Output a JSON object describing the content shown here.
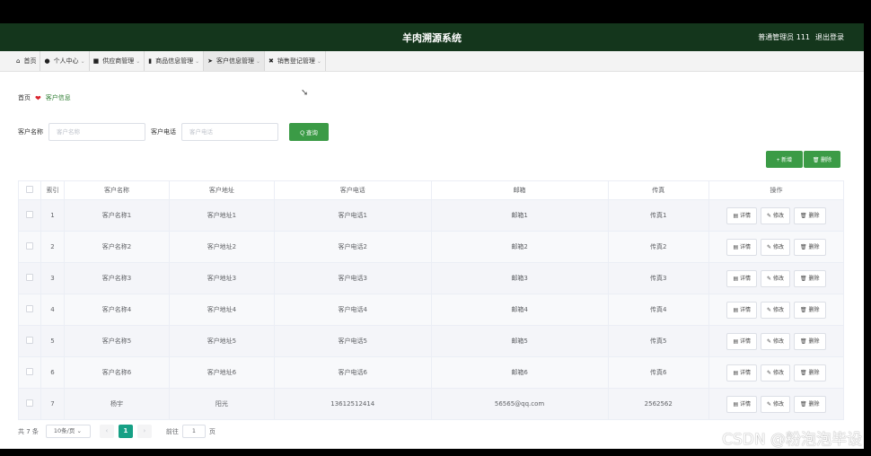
{
  "header": {
    "title": "羊肉溯源系统",
    "user": "普通管理员 111",
    "logout": "退出登录"
  },
  "nav": [
    {
      "icon": "⌂",
      "label": "首页",
      "chevron": false
    },
    {
      "icon": "●",
      "label": "个人中心",
      "chevron": true
    },
    {
      "icon": "■",
      "label": "供应商管理",
      "chevron": true
    },
    {
      "icon": "▮",
      "label": "商品信息管理",
      "chevron": true
    },
    {
      "icon": "➤",
      "label": "客户信息管理",
      "chevron": true
    },
    {
      "icon": "✖",
      "label": "销售登记管理",
      "chevron": true
    }
  ],
  "breadcrumb": {
    "home": "首页",
    "current": "客户信息"
  },
  "search": {
    "name_label": "客户名称",
    "name_placeholder": "客户名称",
    "phone_label": "客户电话",
    "phone_placeholder": "客户电话",
    "query_label": "Q 查询"
  },
  "toolbar": {
    "add_label": "+ 新增",
    "delete_label": "🗑 删除"
  },
  "table": {
    "headers": [
      "索引",
      "客户名称",
      "客户地址",
      "客户电话",
      "邮箱",
      "传真",
      "操作"
    ],
    "rows": [
      [
        "1",
        "客户名称1",
        "客户地址1",
        "客户电话1",
        "邮箱1",
        "传真1"
      ],
      [
        "2",
        "客户名称2",
        "客户地址2",
        "客户电话2",
        "邮箱2",
        "传真2"
      ],
      [
        "3",
        "客户名称3",
        "客户地址3",
        "客户电话3",
        "邮箱3",
        "传真3"
      ],
      [
        "4",
        "客户名称4",
        "客户地址4",
        "客户电话4",
        "邮箱4",
        "传真4"
      ],
      [
        "5",
        "客户名称5",
        "客户地址5",
        "客户电话5",
        "邮箱5",
        "传真5"
      ],
      [
        "6",
        "客户名称6",
        "客户地址6",
        "客户电话6",
        "邮箱6",
        "传真6"
      ],
      [
        "7",
        "杨宇",
        "阳光",
        "13612512414",
        "56565@qq.com",
        "2562562"
      ]
    ],
    "actions": {
      "detail": "▤ 详情",
      "edit": "✎ 修改",
      "delete": "🗑 删除"
    }
  },
  "pager": {
    "total": "共 7 条",
    "size": "10条/页",
    "current_page": "1",
    "goto_prefix": "前往",
    "goto_value": "1",
    "goto_suffix": "页"
  },
  "watermark": "CSDN @粉泡泡毕设"
}
